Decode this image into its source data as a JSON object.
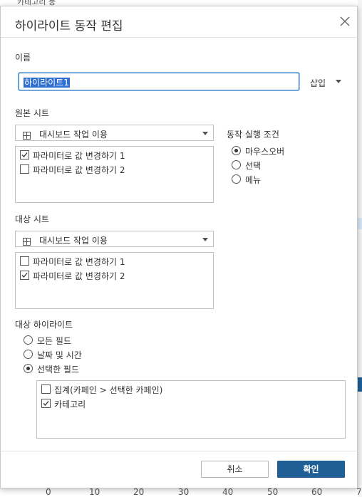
{
  "dialog": {
    "title": "하이라이트 동작 편집"
  },
  "name": {
    "label": "이름",
    "value": "하이라이트1",
    "insert_label": "삽입"
  },
  "source": {
    "label": "원본 시트",
    "dropdown": "대시보드 작업 이용",
    "items": [
      {
        "label": "파라미터로 값 변경하기 1",
        "checked": true
      },
      {
        "label": "파라미터로 값 변경하기 2",
        "checked": false
      }
    ]
  },
  "run_condition": {
    "label": "동작 실행 조건",
    "options": [
      {
        "label": "마우스오버",
        "selected": true
      },
      {
        "label": "선택",
        "selected": false
      },
      {
        "label": "메뉴",
        "selected": false
      }
    ]
  },
  "target": {
    "label": "대상 시트",
    "dropdown": "대시보드 작업 이용",
    "items": [
      {
        "label": "파라미터로 값 변경하기 1",
        "checked": false
      },
      {
        "label": "파라미터로 값 변경하기 2",
        "checked": true
      }
    ]
  },
  "target_highlight": {
    "label": "대상 하이라이트",
    "options": [
      {
        "label": "모든 필드",
        "selected": false
      },
      {
        "label": "날짜 및 시간",
        "selected": false
      },
      {
        "label": "선택한 필드",
        "selected": true
      }
    ],
    "fields": [
      {
        "label": "집계(카페인 > 선택한 카페인)",
        "checked": false
      },
      {
        "label": "카테고리",
        "checked": true
      }
    ]
  },
  "buttons": {
    "cancel": "취소",
    "ok": "확인"
  },
  "background": {
    "top_text": "카테고리 등",
    "axis_ticks": [
      "0",
      "10",
      "20",
      "30",
      "40",
      "50",
      "60",
      "7"
    ]
  },
  "colors": {
    "accent": "#1f5f95",
    "focus": "#2f7ac3",
    "selection": "#2f6fd1"
  }
}
